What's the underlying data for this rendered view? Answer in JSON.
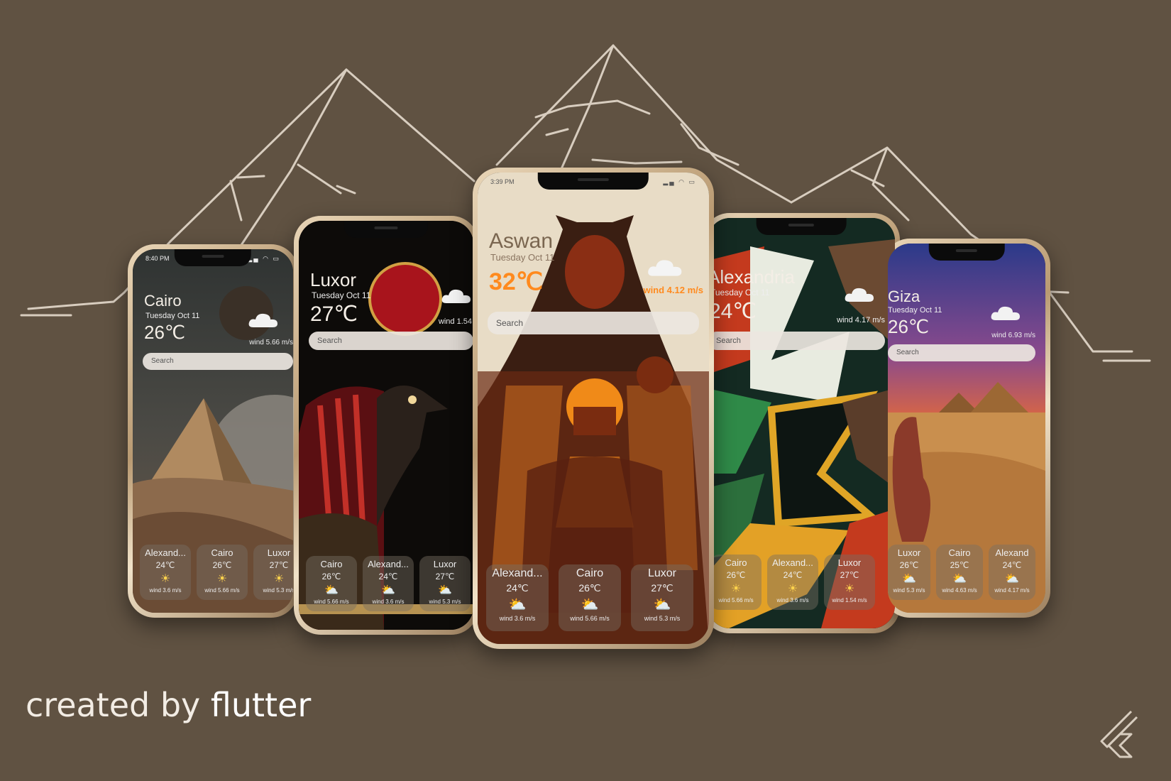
{
  "background_color": "#605242",
  "footer": {
    "prefix": "created by",
    "brand": "flutter"
  },
  "phones": [
    {
      "id": "cairo",
      "time": "8:40 PM",
      "city": "Cairo",
      "date": "Tuesday Oct 11",
      "temp": "26℃",
      "wind": "wind 5.66 m/s",
      "search_placeholder": "Search",
      "cards": [
        {
          "name": "Alexand...",
          "temp": "24℃",
          "wind": "wind 3.6 m/s"
        },
        {
          "name": "Cairo",
          "temp": "26℃",
          "wind": "wind 5.66 m/s"
        },
        {
          "name": "Luxor",
          "temp": "27℃",
          "wind": "wind 5.3 m/s"
        }
      ]
    },
    {
      "id": "luxor",
      "time": "",
      "city": "Luxor",
      "date": "Tuesday Oct 11",
      "temp": "27℃",
      "wind": "wind 1.54",
      "search_placeholder": "Search",
      "cards": [
        {
          "name": "Cairo",
          "temp": "26℃",
          "wind": "wind 5.66 m/s"
        },
        {
          "name": "Alexand...",
          "temp": "24℃",
          "wind": "wind 3.6 m/s"
        },
        {
          "name": "Luxor",
          "temp": "27℃",
          "wind": "wind 5.3 m/s"
        }
      ]
    },
    {
      "id": "aswan",
      "time": "3:39 PM",
      "city": "Aswan",
      "date": "Tuesday Oct 11",
      "temp": "32℃",
      "wind": "wind 4.12 m/s",
      "search_placeholder": "Search",
      "cards": [
        {
          "name": "Alexand...",
          "temp": "24℃",
          "wind": "wind 3.6 m/s"
        },
        {
          "name": "Cairo",
          "temp": "26℃",
          "wind": "wind 5.66 m/s"
        },
        {
          "name": "Luxor",
          "temp": "27℃",
          "wind": "wind 5.3 m/s"
        }
      ]
    },
    {
      "id": "alexandria",
      "time": "",
      "city": "Alexandria",
      "date": "Tuesday Oct 11",
      "temp": "24℃",
      "wind": "wind 4.17 m/s",
      "search_placeholder": "Search",
      "cards": [
        {
          "name": "Cairo",
          "temp": "26℃",
          "wind": "wind 5.66 m/s"
        },
        {
          "name": "Alexand...",
          "temp": "24℃",
          "wind": "wind 3.6 m/s"
        },
        {
          "name": "Luxor",
          "temp": "27℃",
          "wind": "wind 1.54 m/s"
        }
      ]
    },
    {
      "id": "giza",
      "time": "",
      "city": "Giza",
      "date": "Tuesday Oct 11",
      "temp": "26℃",
      "wind": "wind 6.93 m/s",
      "search_placeholder": "Search",
      "cards": [
        {
          "name": "Luxor",
          "temp": "26℃",
          "wind": "wind 5.3 m/s"
        },
        {
          "name": "Cairo",
          "temp": "25℃",
          "wind": "wind 4.63 m/s"
        },
        {
          "name": "Alexand",
          "temp": "24℃",
          "wind": "wind 4.17 m/s"
        }
      ]
    }
  ]
}
